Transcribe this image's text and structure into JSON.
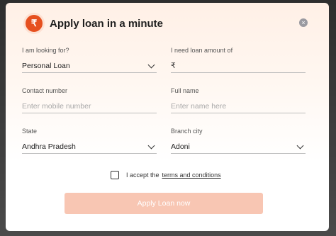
{
  "modal": {
    "title": "Apply loan in a minute",
    "badge_symbol": "₹",
    "close_symbol": "×"
  },
  "form": {
    "looking_for": {
      "label": "I am looking for?",
      "value": "Personal Loan"
    },
    "loan_amount": {
      "label": "I need loan amount of",
      "prefix": "₹",
      "value": ""
    },
    "contact": {
      "label": "Contact number",
      "placeholder": "Enter mobile number"
    },
    "full_name": {
      "label": "Full name",
      "placeholder": "Enter name here"
    },
    "state": {
      "label": "State",
      "value": "Andhra Pradesh"
    },
    "branch_city": {
      "label": "Branch city",
      "value": "Adoni"
    }
  },
  "consent": {
    "text": "I accept the",
    "link": "terms and conditions",
    "checked": false
  },
  "submit": {
    "label": "Apply Loan now"
  },
  "colors": {
    "accent": "#e6501f",
    "button_disabled": "#f8c6b3"
  }
}
